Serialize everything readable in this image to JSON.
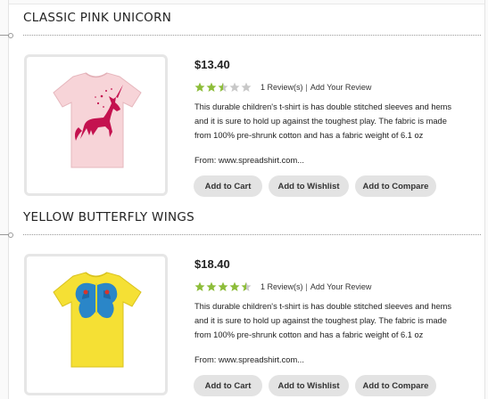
{
  "products": [
    {
      "title": "CLASSIC PINK UNICORN",
      "price": "$13.40",
      "rating": 2.5,
      "rating_max": 5,
      "reviews_label": "1 Review(s)",
      "add_review_label": "Add Your Review",
      "description": "This durable children's t-shirt is has double stitched sleeves and hems and it is sure to hold up against the toughest play. The fabric is made from 100% pre-shrunk cotton and has a fabric weight of 6.1 oz",
      "from": "From: www.spreadshirt.com...",
      "shirt_color": "#f7d4d8",
      "print": "pink-unicorn",
      "buttons": {
        "cart": "Add to Cart",
        "wishlist": "Add to Wishlist",
        "compare": "Add to Compare"
      }
    },
    {
      "title": "YELLOW BUTTERFLY WINGS",
      "price": "$18.40",
      "rating": 4.5,
      "rating_max": 5,
      "reviews_label": "1 Review(s)",
      "add_review_label": "Add Your Review",
      "description": "This durable children's t-shirt is has double stitched sleeves and hems and it is sure to hold up against the toughest play. The fabric is made from 100% pre-shrunk cotton and has a fabric weight of 6.1 oz",
      "from": "From: www.spreadshirt.com...",
      "shirt_color": "#f5e034",
      "print": "blue-butterfly-wings",
      "buttons": {
        "cart": "Add to Cart",
        "wishlist": "Add to Wishlist",
        "compare": "Add to Compare"
      }
    }
  ],
  "colors": {
    "star_on": "#8dbd3a",
    "star_off": "#c8c8c8",
    "button_bg": "#e3e3e3"
  }
}
